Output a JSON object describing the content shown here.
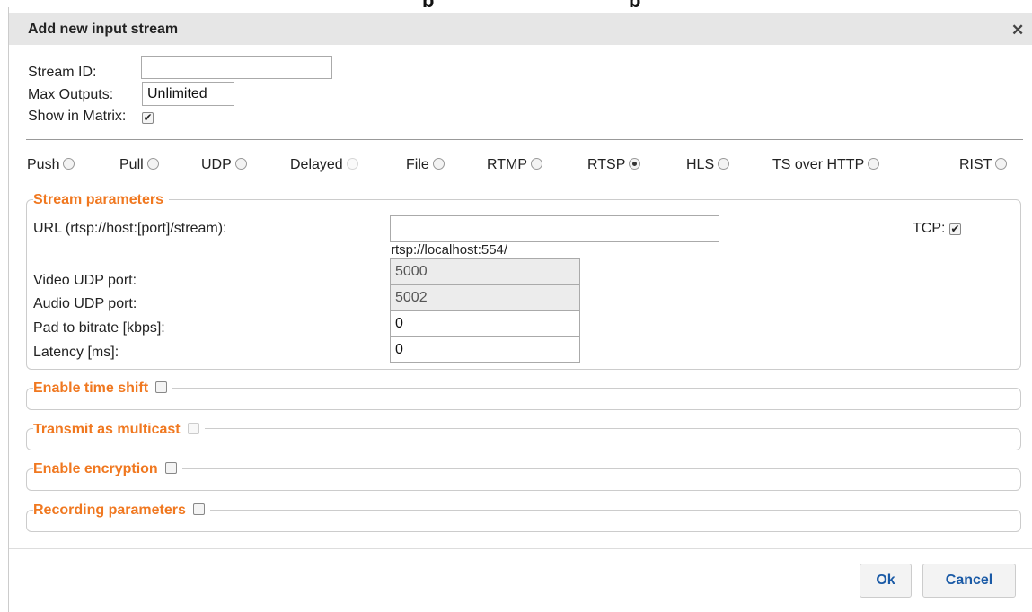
{
  "dialog": {
    "title": "Add new input stream",
    "close_symbol": "✕"
  },
  "general": {
    "stream_id_label": "Stream ID:",
    "stream_id_value": "",
    "max_outputs_label": "Max Outputs:",
    "max_outputs_value": "Unlimited",
    "show_in_matrix_label": "Show in Matrix:",
    "show_in_matrix_checked": true
  },
  "stream_types": [
    {
      "label": "Push",
      "selected": false,
      "disabled": false
    },
    {
      "label": "Pull",
      "selected": false,
      "disabled": false
    },
    {
      "label": "UDP",
      "selected": false,
      "disabled": false
    },
    {
      "label": "Delayed",
      "selected": false,
      "disabled": true
    },
    {
      "label": "File",
      "selected": false,
      "disabled": false
    },
    {
      "label": "RTMP",
      "selected": false,
      "disabled": false
    },
    {
      "label": "RTSP",
      "selected": true,
      "disabled": false
    },
    {
      "label": "HLS",
      "selected": false,
      "disabled": false
    },
    {
      "label": "TS over HTTP",
      "selected": false,
      "disabled": false
    },
    {
      "label": "RIST",
      "selected": false,
      "disabled": false
    }
  ],
  "stream_parameters": {
    "legend": "Stream parameters",
    "url_label": "URL (rtsp://host:[port]/stream):",
    "url_value": "",
    "url_hint": "rtsp://localhost:554/",
    "tcp_label": "TCP:",
    "tcp_checked": true,
    "video_udp_label": "Video UDP port:",
    "video_udp_value": "5000",
    "audio_udp_label": "Audio UDP port:",
    "audio_udp_value": "5002",
    "pad_label": "Pad to bitrate [kbps]:",
    "pad_value": "0",
    "latency_label": "Latency [ms]:",
    "latency_value": "0"
  },
  "sections": {
    "time_shift": "Enable time shift",
    "multicast": "Transmit as multicast",
    "encryption": "Enable encryption",
    "recording": "Recording parameters"
  },
  "buttons": {
    "ok": "Ok",
    "cancel": "Cancel"
  },
  "colors": {
    "legend_accent": "#f07820",
    "button_text": "#1a5aa6",
    "titlebar": "#e6e6e6"
  }
}
